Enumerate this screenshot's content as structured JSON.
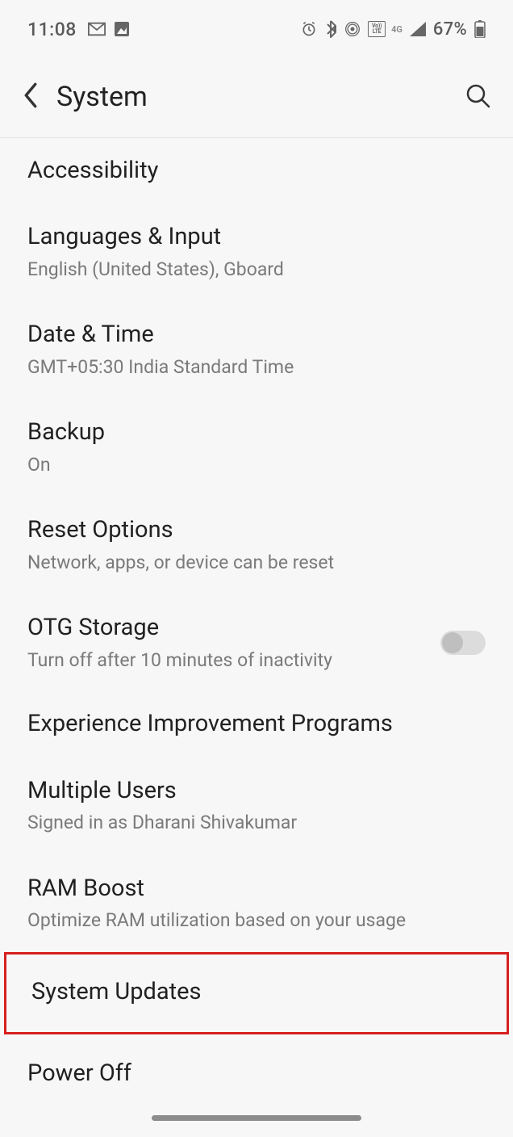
{
  "statusbar": {
    "time": "11:08",
    "battery_pct": "67%"
  },
  "header": {
    "title": "System"
  },
  "items": {
    "accessibility": {
      "title": "Accessibility"
    },
    "languages": {
      "title": "Languages & Input",
      "subtitle": "English (United States), Gboard"
    },
    "datetime": {
      "title": "Date & Time",
      "subtitle": "GMT+05:30 India Standard Time"
    },
    "backup": {
      "title": "Backup",
      "subtitle": "On"
    },
    "reset": {
      "title": "Reset Options",
      "subtitle": "Network, apps, or device can be reset"
    },
    "otg": {
      "title": "OTG Storage",
      "subtitle": "Turn off after 10 minutes of inactivity",
      "toggle": false
    },
    "experience": {
      "title": "Experience Improvement Programs"
    },
    "multiusers": {
      "title": "Multiple Users",
      "subtitle": "Signed in as Dharani Shivakumar"
    },
    "ramboost": {
      "title": "RAM Boost",
      "subtitle": "Optimize RAM utilization based on your usage"
    },
    "sysupdates": {
      "title": "System Updates"
    },
    "poweroff": {
      "title": "Power Off"
    }
  },
  "network_label": "4G"
}
